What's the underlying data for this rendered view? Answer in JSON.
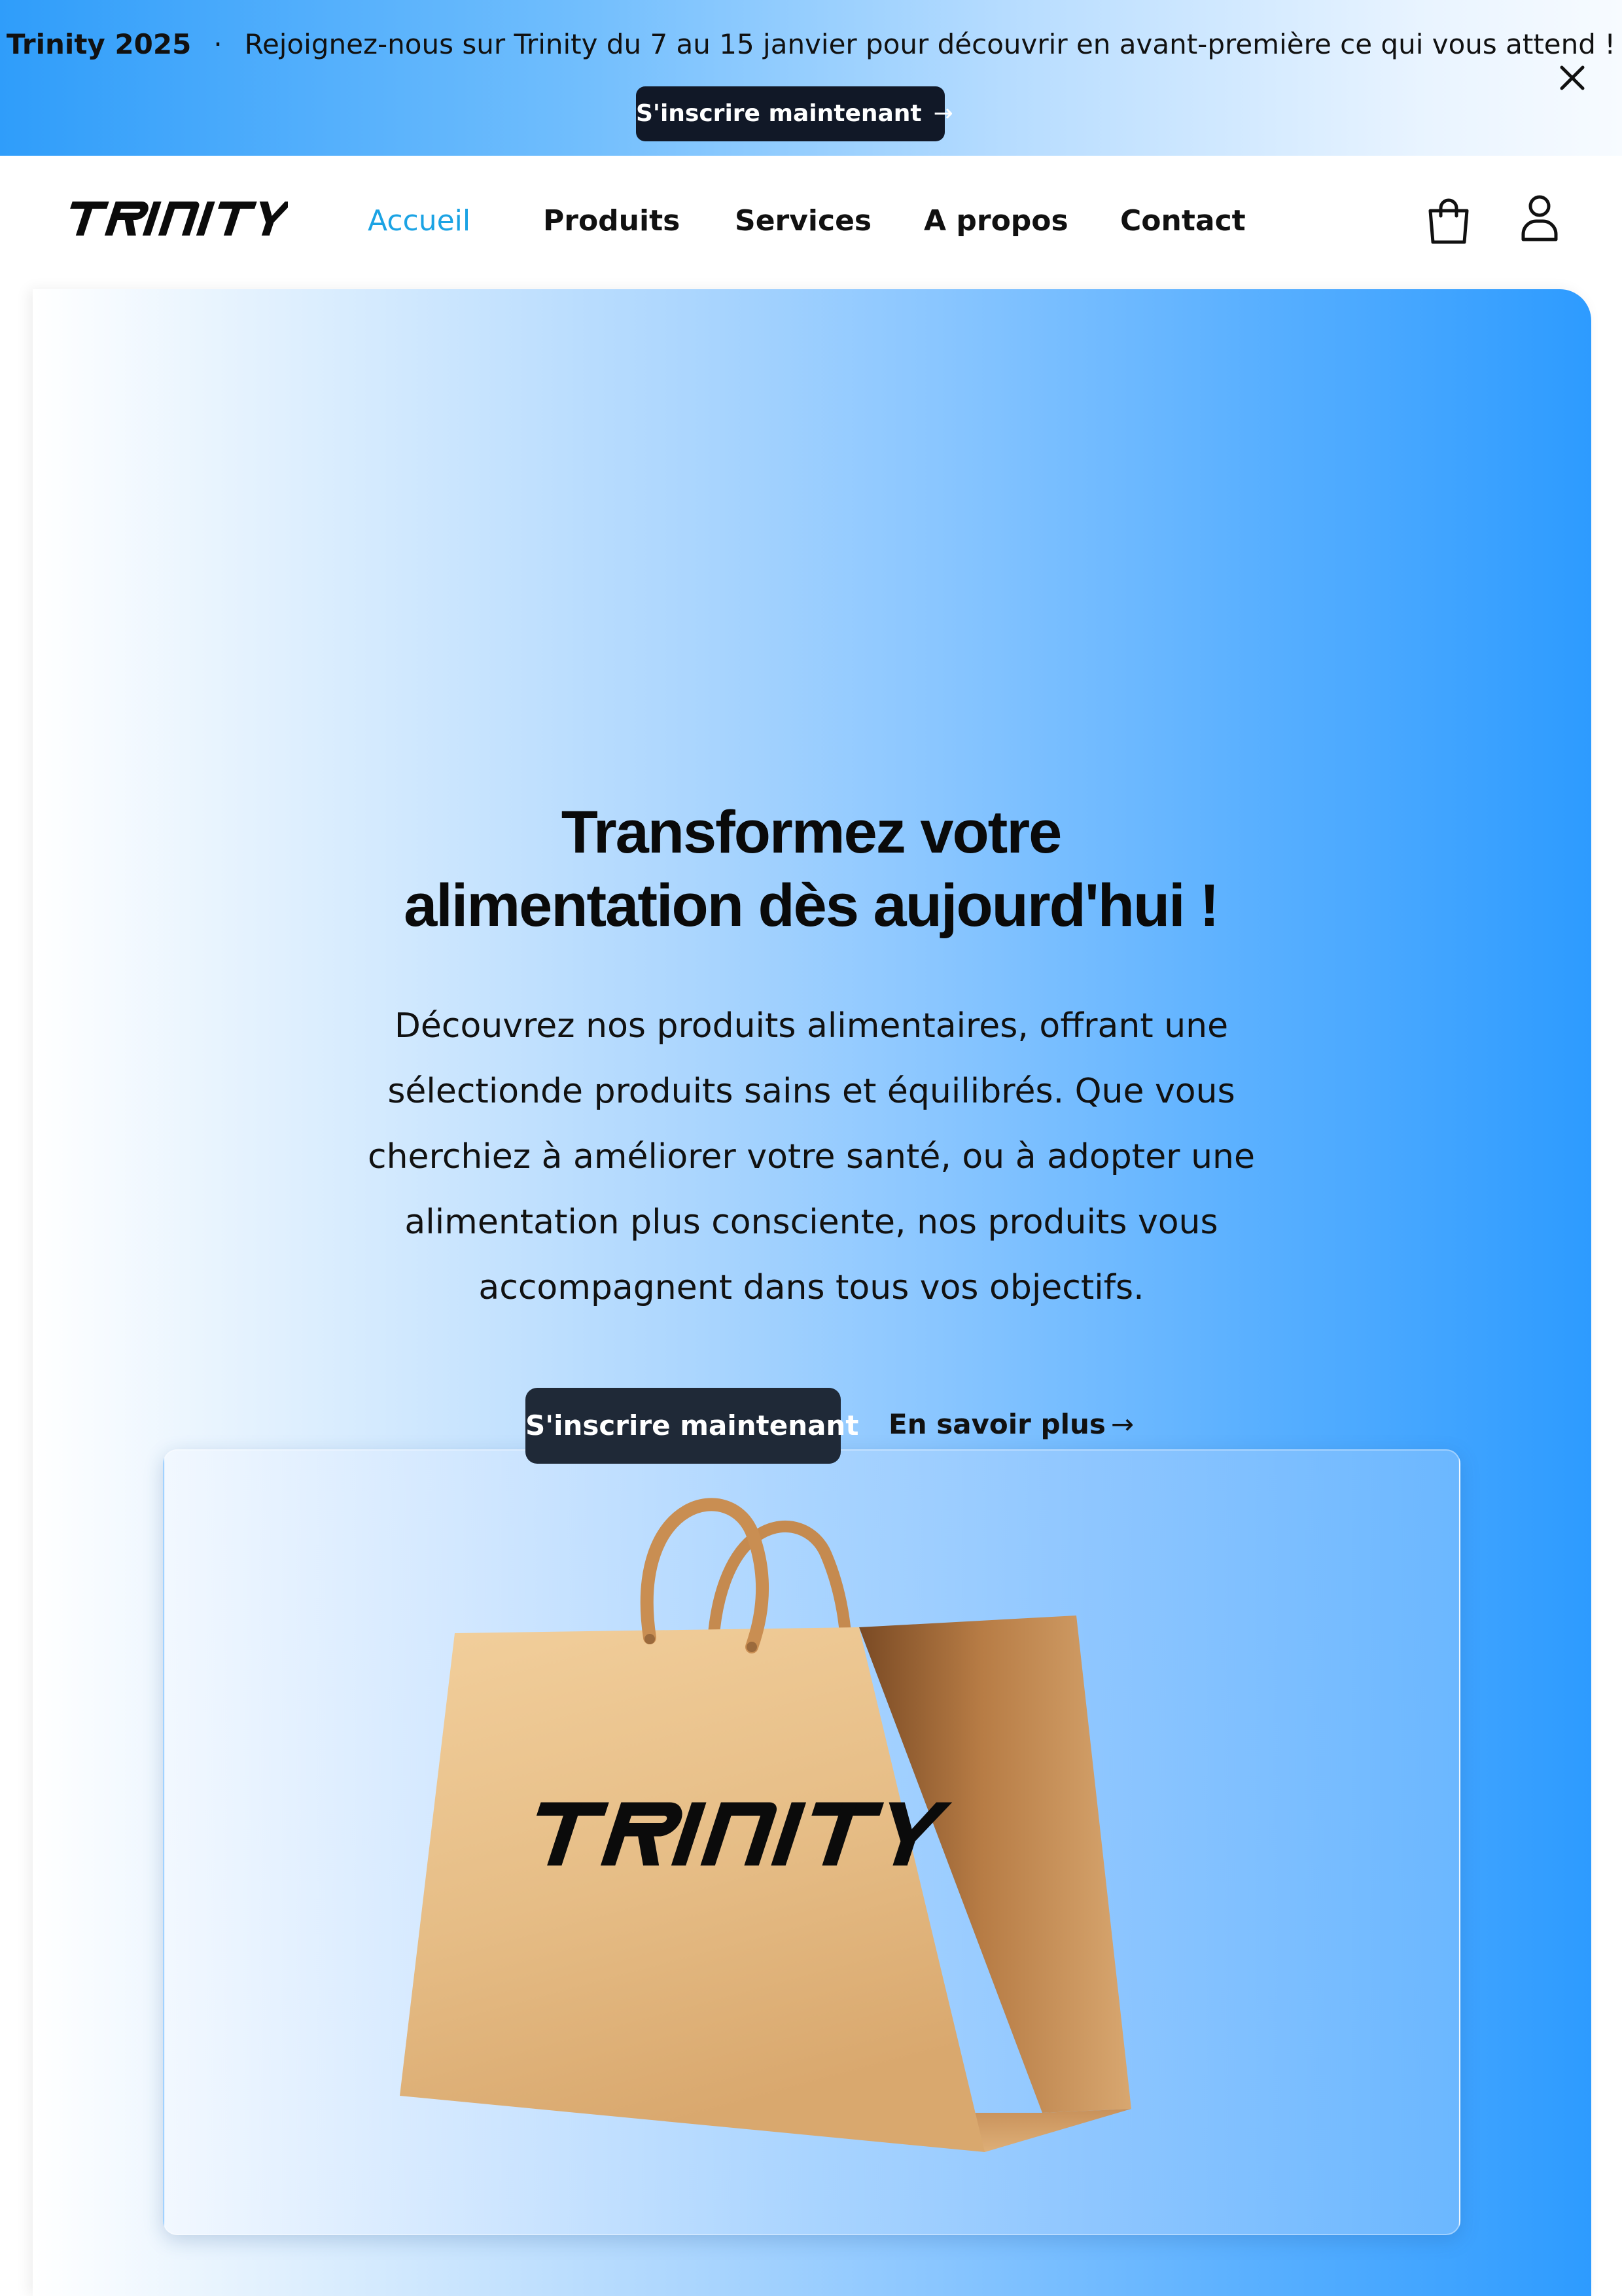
{
  "banner": {
    "event_name": "Trinity 2025",
    "separator": "·",
    "message": "Rejoignez-nous sur Trinity du 7 au 15 janvier pour découvrir en avant-première ce qui vous attend !",
    "cta_label": "S'inscrire maintenant",
    "cta_arrow": "→",
    "close_icon": "close-icon"
  },
  "nav": {
    "logo_text": "TRINITY",
    "links": [
      {
        "label": "Accueil",
        "active": true
      },
      {
        "label": "Produits",
        "active": false
      },
      {
        "label": "Services",
        "active": false
      },
      {
        "label": "A propos",
        "active": false
      },
      {
        "label": "Contact",
        "active": false
      }
    ],
    "icons": [
      "shopping-bag-icon",
      "user-icon"
    ]
  },
  "hero": {
    "title_line1": "Transformez votre",
    "title_line2": "alimentation dès aujourd'hui !",
    "description": "Découvrez nos produits alimentaires, offrant une sélectionde produits sains et équilibrés. Que vous cherchiez à améliorer votre santé, ou à adopter une alimentation plus consciente, nos produits vous accompagnent dans tous vos objectifs.",
    "primary_cta": "S'inscrire maintenant",
    "secondary_cta": "En savoir plus",
    "secondary_arrow": "→",
    "image": {
      "subject": "shopping-bag-illustration",
      "bag_logo_text": "TRINITY"
    }
  },
  "colors": {
    "accent": "#1ba3e4",
    "dark_button": "#1f2937",
    "hero_gradient_end": "#2d9bff"
  }
}
